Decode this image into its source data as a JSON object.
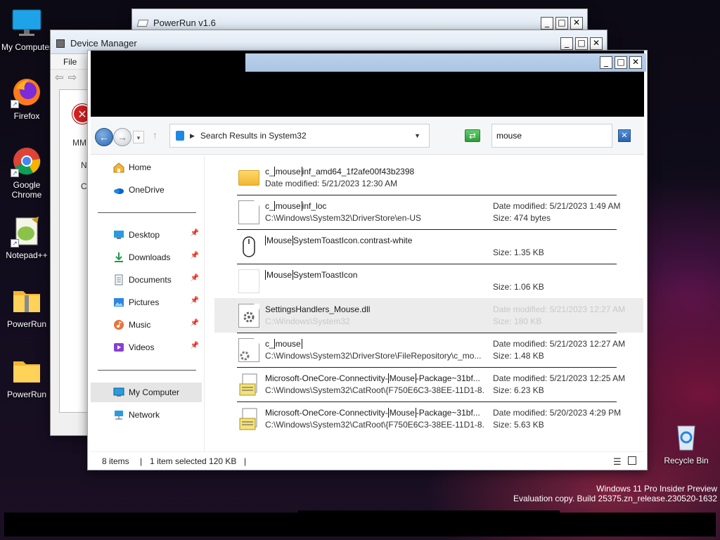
{
  "desktop": {
    "icons": [
      {
        "label": "My Computer",
        "icon": "monitor-icon"
      },
      {
        "label": "Firefox",
        "icon": "firefox-icon"
      },
      {
        "label": "Google Chrome",
        "icon": "chrome-icon"
      },
      {
        "label": "Notepad++",
        "icon": "notepadpp-icon"
      },
      {
        "label": "PowerRun",
        "icon": "zip-folder-icon"
      },
      {
        "label": "PowerRun",
        "icon": "folder-icon"
      }
    ],
    "recycle_bin": "Recycle Bin",
    "watermark_line1": "Windows 11 Pro Insider Preview",
    "watermark_line2": "Evaluation copy. Build 25375.zn_release.230520-1632"
  },
  "powerrun_window": {
    "title": "PowerRun v1.6"
  },
  "device_manager": {
    "title": "Device Manager",
    "menu_file": "File",
    "text1": "MM",
    "text2": "N",
    "text3": "C"
  },
  "explorer": {
    "address": "Search Results in System32",
    "search_value": "mouse",
    "nav": {
      "home": "Home",
      "onedrive": "OneDrive",
      "desktop": "Desktop",
      "downloads": "Downloads",
      "documents": "Documents",
      "pictures": "Pictures",
      "music": "Music",
      "videos": "Videos",
      "my_computer": "My Computer",
      "network": "Network"
    },
    "files": [
      {
        "pre": "c_",
        "hl": "mouse",
        "post": "inf_amd64_1f2afe00f43b2398",
        "sub": "Date modified: 5/21/2023 12:30 AM",
        "m1": "",
        "m2": ""
      },
      {
        "pre": "c_",
        "hl": "mouse",
        "post": "inf_loc",
        "sub": "C:\\Windows\\System32\\DriverStore\\en-US",
        "m1": "Date modified: 5/21/2023 1:49 AM",
        "m2": "Size: 474 bytes"
      },
      {
        "pre": "",
        "hl": "Mouse",
        "post": "SystemToastIcon.contrast-white",
        "sub": "",
        "m1": "",
        "m2": "Size: 1.35 KB"
      },
      {
        "pre": "",
        "hl": "Mouse",
        "post": "SystemToastIcon",
        "sub": "",
        "m1": "",
        "m2": "Size: 1.06 KB"
      },
      {
        "pre": "SettingsHandlers_Mouse.dll",
        "hl": "",
        "post": "",
        "sub": "C:\\Windows\\System32",
        "m1": "Date modified: 5/21/2023 12:27 AM",
        "m2": "Size: 180 KB"
      },
      {
        "pre": "c_",
        "hl": "mouse",
        "post": "",
        "sub": "C:\\Windows\\System32\\DriverStore\\FileRepository\\c_mo...",
        "m1": "Date modified: 5/21/2023 12:27 AM",
        "m2": "Size: 1.48 KB"
      },
      {
        "pre": "Microsoft-OneCore-Connectivity-",
        "hl": "Mouse",
        "post": "-Package~31bf...",
        "sub": "C:\\Windows\\System32\\CatRoot\\{F750E6C3-38EE-11D1-8...",
        "m1": "Date modified: 5/21/2023 12:25 AM",
        "m2": "Size: 6.23 KB"
      },
      {
        "pre": "Microsoft-OneCore-Connectivity-",
        "hl": "Mouse",
        "post": "-Package~31bf...",
        "sub": "C:\\Windows\\System32\\CatRoot\\{F750E6C3-38EE-11D1-8...",
        "m1": "Date modified: 5/20/2023 4:29 PM",
        "m2": "Size: 5.63 KB"
      }
    ],
    "status": {
      "items": "8 items",
      "selected": "1 item selected  120 KB",
      "sep": "|"
    }
  },
  "window_buttons": {
    "minimize": "_",
    "maximize": "□",
    "close": "✕"
  }
}
